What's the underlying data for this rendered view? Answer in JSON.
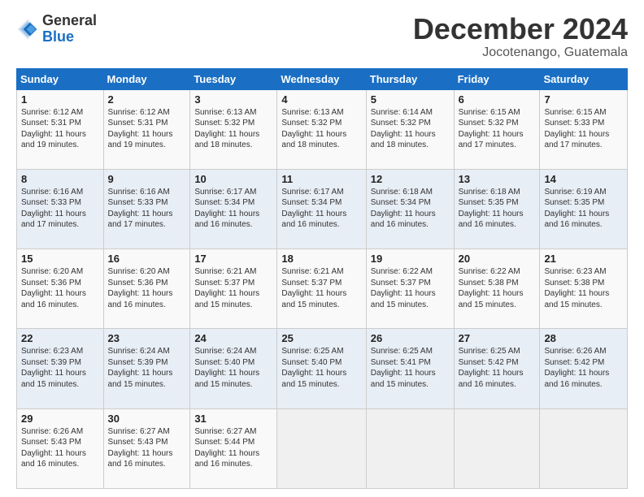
{
  "header": {
    "logo_general": "General",
    "logo_blue": "Blue",
    "month_title": "December 2024",
    "location": "Jocotenango, Guatemala"
  },
  "weekdays": [
    "Sunday",
    "Monday",
    "Tuesday",
    "Wednesday",
    "Thursday",
    "Friday",
    "Saturday"
  ],
  "weeks": [
    [
      {
        "day": "1",
        "info": "Sunrise: 6:12 AM\nSunset: 5:31 PM\nDaylight: 11 hours\nand 19 minutes."
      },
      {
        "day": "2",
        "info": "Sunrise: 6:12 AM\nSunset: 5:31 PM\nDaylight: 11 hours\nand 19 minutes."
      },
      {
        "day": "3",
        "info": "Sunrise: 6:13 AM\nSunset: 5:32 PM\nDaylight: 11 hours\nand 18 minutes."
      },
      {
        "day": "4",
        "info": "Sunrise: 6:13 AM\nSunset: 5:32 PM\nDaylight: 11 hours\nand 18 minutes."
      },
      {
        "day": "5",
        "info": "Sunrise: 6:14 AM\nSunset: 5:32 PM\nDaylight: 11 hours\nand 18 minutes."
      },
      {
        "day": "6",
        "info": "Sunrise: 6:15 AM\nSunset: 5:32 PM\nDaylight: 11 hours\nand 17 minutes."
      },
      {
        "day": "7",
        "info": "Sunrise: 6:15 AM\nSunset: 5:33 PM\nDaylight: 11 hours\nand 17 minutes."
      }
    ],
    [
      {
        "day": "8",
        "info": "Sunrise: 6:16 AM\nSunset: 5:33 PM\nDaylight: 11 hours\nand 17 minutes."
      },
      {
        "day": "9",
        "info": "Sunrise: 6:16 AM\nSunset: 5:33 PM\nDaylight: 11 hours\nand 17 minutes."
      },
      {
        "day": "10",
        "info": "Sunrise: 6:17 AM\nSunset: 5:34 PM\nDaylight: 11 hours\nand 16 minutes."
      },
      {
        "day": "11",
        "info": "Sunrise: 6:17 AM\nSunset: 5:34 PM\nDaylight: 11 hours\nand 16 minutes."
      },
      {
        "day": "12",
        "info": "Sunrise: 6:18 AM\nSunset: 5:34 PM\nDaylight: 11 hours\nand 16 minutes."
      },
      {
        "day": "13",
        "info": "Sunrise: 6:18 AM\nSunset: 5:35 PM\nDaylight: 11 hours\nand 16 minutes."
      },
      {
        "day": "14",
        "info": "Sunrise: 6:19 AM\nSunset: 5:35 PM\nDaylight: 11 hours\nand 16 minutes."
      }
    ],
    [
      {
        "day": "15",
        "info": "Sunrise: 6:20 AM\nSunset: 5:36 PM\nDaylight: 11 hours\nand 16 minutes."
      },
      {
        "day": "16",
        "info": "Sunrise: 6:20 AM\nSunset: 5:36 PM\nDaylight: 11 hours\nand 16 minutes."
      },
      {
        "day": "17",
        "info": "Sunrise: 6:21 AM\nSunset: 5:37 PM\nDaylight: 11 hours\nand 15 minutes."
      },
      {
        "day": "18",
        "info": "Sunrise: 6:21 AM\nSunset: 5:37 PM\nDaylight: 11 hours\nand 15 minutes."
      },
      {
        "day": "19",
        "info": "Sunrise: 6:22 AM\nSunset: 5:37 PM\nDaylight: 11 hours\nand 15 minutes."
      },
      {
        "day": "20",
        "info": "Sunrise: 6:22 AM\nSunset: 5:38 PM\nDaylight: 11 hours\nand 15 minutes."
      },
      {
        "day": "21",
        "info": "Sunrise: 6:23 AM\nSunset: 5:38 PM\nDaylight: 11 hours\nand 15 minutes."
      }
    ],
    [
      {
        "day": "22",
        "info": "Sunrise: 6:23 AM\nSunset: 5:39 PM\nDaylight: 11 hours\nand 15 minutes."
      },
      {
        "day": "23",
        "info": "Sunrise: 6:24 AM\nSunset: 5:39 PM\nDaylight: 11 hours\nand 15 minutes."
      },
      {
        "day": "24",
        "info": "Sunrise: 6:24 AM\nSunset: 5:40 PM\nDaylight: 11 hours\nand 15 minutes."
      },
      {
        "day": "25",
        "info": "Sunrise: 6:25 AM\nSunset: 5:40 PM\nDaylight: 11 hours\nand 15 minutes."
      },
      {
        "day": "26",
        "info": "Sunrise: 6:25 AM\nSunset: 5:41 PM\nDaylight: 11 hours\nand 15 minutes."
      },
      {
        "day": "27",
        "info": "Sunrise: 6:25 AM\nSunset: 5:42 PM\nDaylight: 11 hours\nand 16 minutes."
      },
      {
        "day": "28",
        "info": "Sunrise: 6:26 AM\nSunset: 5:42 PM\nDaylight: 11 hours\nand 16 minutes."
      }
    ],
    [
      {
        "day": "29",
        "info": "Sunrise: 6:26 AM\nSunset: 5:43 PM\nDaylight: 11 hours\nand 16 minutes."
      },
      {
        "day": "30",
        "info": "Sunrise: 6:27 AM\nSunset: 5:43 PM\nDaylight: 11 hours\nand 16 minutes."
      },
      {
        "day": "31",
        "info": "Sunrise: 6:27 AM\nSunset: 5:44 PM\nDaylight: 11 hours\nand 16 minutes."
      },
      {
        "day": "",
        "info": ""
      },
      {
        "day": "",
        "info": ""
      },
      {
        "day": "",
        "info": ""
      },
      {
        "day": "",
        "info": ""
      }
    ]
  ]
}
